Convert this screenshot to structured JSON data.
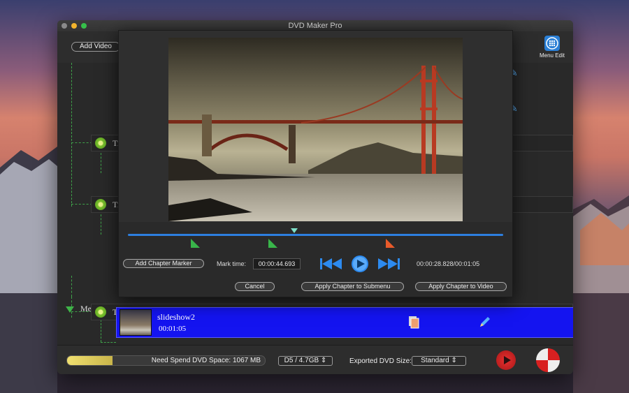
{
  "window": {
    "title": "DVD Maker Pro"
  },
  "toolbar": {
    "add_video_label": "Add Video",
    "menu_edit_label": "Menu Edit"
  },
  "tree": {
    "title_prefix_1": "Ti",
    "title_prefix_2": "Ti",
    "title_prefix_3": "Ti",
    "menu_page_label": "Menu Page"
  },
  "selected_item": {
    "name": "slideshow2",
    "duration": "00:01:05"
  },
  "bottom": {
    "space_text": "Need Spend DVD Space: 1067 MB",
    "space_fill_fraction": 0.23,
    "disc_select": "D5 / 4.7GB",
    "export_label": "Exported DVD Size:",
    "export_select": "Standard"
  },
  "dialog": {
    "add_chapter_marker": "Add Chapter Marker",
    "mark_time_label": "Mark time:",
    "mark_time_value": "00:00:44.693",
    "time_readout": "00:00:28.828/00:01:05",
    "cancel": "Cancel",
    "apply_submenu": "Apply Chapter to Submenu",
    "apply_video": "Apply Chapter to Video"
  },
  "colors": {
    "accent_blue": "#2d7fe0",
    "selection": "#1414f0",
    "marker_green": "#39b54a",
    "marker_orange": "#e85a2a"
  },
  "icons": [
    "add-video",
    "menu-edit-icon",
    "disc-icon",
    "pencil-icon",
    "copy-icon",
    "skip-back-icon",
    "play-icon",
    "skip-forward-icon",
    "burn-icon",
    "disc-burn-icon"
  ]
}
